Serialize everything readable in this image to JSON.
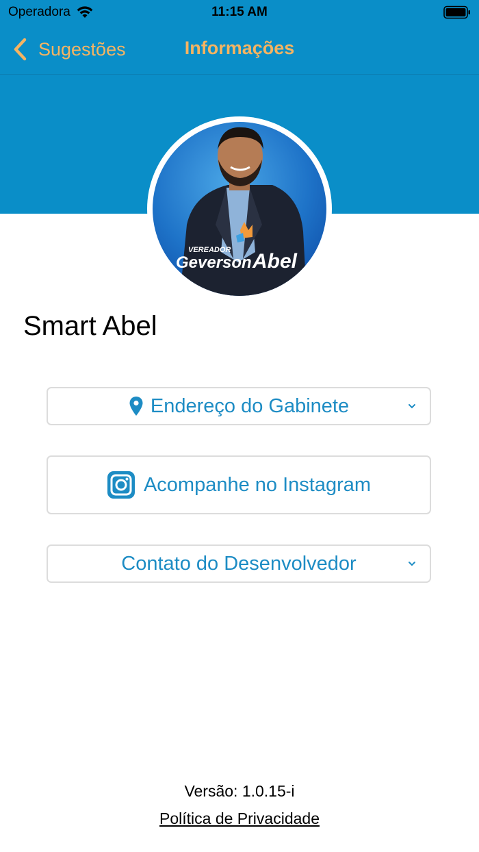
{
  "status_bar": {
    "carrier": "Operadora",
    "time": "11:15 AM",
    "icons": [
      "wifi-icon",
      "battery-icon"
    ]
  },
  "nav": {
    "back_label": "Sugestões",
    "title": "Informações",
    "accent_color": "#f5b462",
    "bar_color": "#0a8ec8"
  },
  "avatar": {
    "logo_small": "VEREADOR",
    "logo_first": "Geverson",
    "logo_last": "Abel"
  },
  "profile": {
    "name": "Smart Abel"
  },
  "buttons": {
    "address": {
      "label": "Endereço do Gabinete",
      "icon": "pin-icon"
    },
    "instagram": {
      "label": "Acompanhe no Instagram",
      "icon": "instagram-icon"
    },
    "contact": {
      "label": "Contato do Desenvolvedor"
    },
    "text_color": "#1d8cc4"
  },
  "footer": {
    "version": "Versão: 1.0.15-i",
    "privacy": "Política de Privacidade"
  }
}
